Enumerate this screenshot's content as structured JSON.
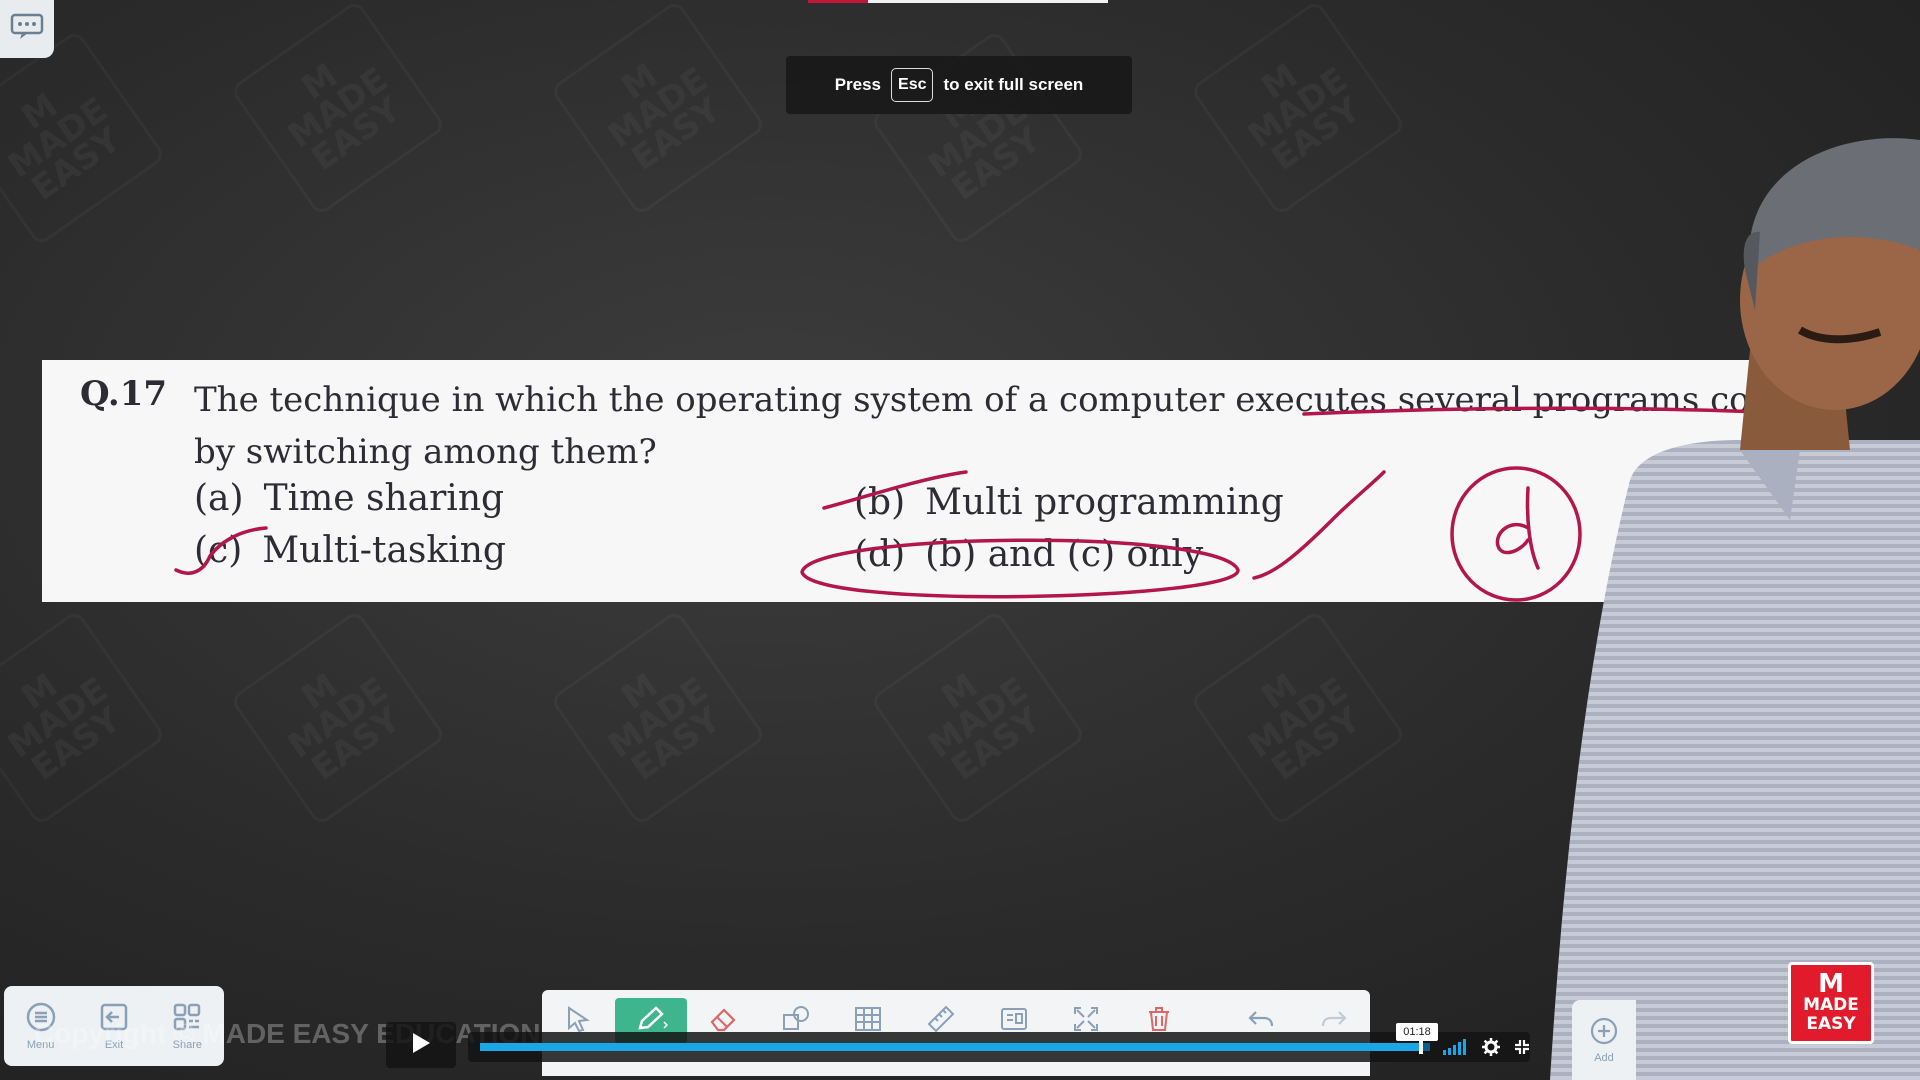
{
  "fullscreen_toast": {
    "press": "Press",
    "key": "Esc",
    "suffix": "to exit full screen"
  },
  "question": {
    "number": "Q.17",
    "text": "The technique in which the operating system of a computer executes several programs concurrently by switching among them?",
    "text_line1": "The technique in which the operating system of a computer executes several programs concurre",
    "text_line2": "by switching among them?",
    "options": [
      {
        "letter": "(a)",
        "text": "Time sharing"
      },
      {
        "letter": "(b)",
        "text": "Multi programming"
      },
      {
        "letter": "(c)",
        "text": "Multi-tasking"
      },
      {
        "letter": "(d)",
        "text": "(b) and (c) only"
      }
    ],
    "handwritten_answer": "d"
  },
  "watermark_text": "MADE EASY",
  "left_toolbar": {
    "items": [
      "Menu",
      "Exit",
      "Share"
    ]
  },
  "copyright": "Copyright © MADE EASY EDUCATION P",
  "main_toolbar": {
    "tools": [
      "select-icon",
      "pen-icon",
      "eraser-icon",
      "shapes-icon",
      "table-icon",
      "ruler-icon",
      "textbox-icon",
      "fit-screen-icon",
      "delete-icon",
      "undo-icon",
      "redo-icon"
    ],
    "active_tool": "pen-icon"
  },
  "add_button": {
    "label": "Add"
  },
  "player": {
    "time_tooltip": "01:18",
    "progress_fraction": 0.99
  },
  "logo": {
    "line1": "MADE",
    "line2": "EASY"
  },
  "colors": {
    "ink": "#b3164a",
    "accent_green": "#3eb58c",
    "seek_blue": "#1aa7e8",
    "brand_red": "#e21b2c"
  }
}
